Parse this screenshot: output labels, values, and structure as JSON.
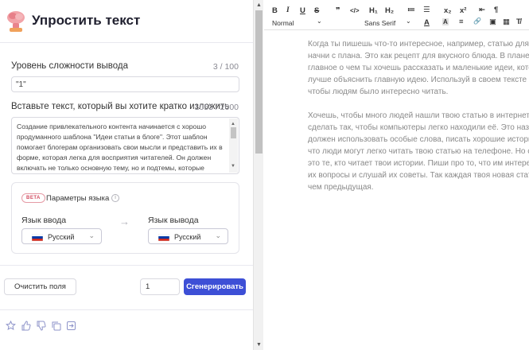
{
  "header": {
    "title": "Упростить текст"
  },
  "complexity": {
    "label": "Уровень сложности вывода",
    "count": "3 / 100",
    "value": "\"1\""
  },
  "source": {
    "label": "Вставьте текст, который вы хотите кратко изложить",
    "count": "1053 / 2000",
    "lines": [
      "Создание привлекательного контента начинается с хорошо",
      "продуманного шаблона \"Идеи статьи в блоге\". Этот шаблон",
      "помогает блогерам организовать свои мысли и представить их в",
      "форме, которая легка для восприятия читателей. Он должен",
      "включать не только основную тему, но и подтемы, которые"
    ]
  },
  "language": {
    "beta": "BETA",
    "title": "Параметры языка",
    "input_label": "Язык ввода",
    "output_label": "Язык вывода",
    "input_value": "Русский",
    "output_value": "Русский",
    "flag_colors": [
      "#ffffff",
      "#0039a6",
      "#d52b1e"
    ]
  },
  "actions": {
    "clear": "Очистить поля",
    "quantity": "1",
    "generate": "Сгенерировать"
  },
  "toolbar": {
    "bold": "B",
    "italic": "I",
    "underline": "U",
    "strike": "S",
    "quote": "❞",
    "code": "</>",
    "h1": "H₁",
    "h2": "H₂",
    "ol": "≔",
    "ul": "☰",
    "sub": "x₂",
    "sup": "x²",
    "indent": "⇤",
    "rtl": "¶",
    "format": "Normal",
    "font": "Sans Serif",
    "font_color": "A",
    "bg_color": "A",
    "align": "≡",
    "link": "🔗",
    "image": "▣",
    "video": "▦",
    "clean": "T̸",
    "source": "<>"
  },
  "editor": {
    "paragraphs": [
      [
        "Когда ты пишешь что-то интересное, например, статью для с",
        "начни с плана. Это как рецепт для вкусного блюда. В плане д",
        "главное о чем ты хочешь рассказать и маленькие идеи, котор",
        "лучше объяснить главную идею. Используй в своем тексте р",
        "чтобы людям было интересно читать."
      ],
      [
        "Хочешь, чтобы много людей нашли твою статью в интернете",
        "сделать так, чтобы компьютеры легко находили её. Это назы",
        "должен использовать особые слова, писать хорошие истори",
        "что люди могут легко читать твою статью на телефоне. Но са",
        "это те, кто читает твои истории. Пиши про то, что им интерес",
        "их вопросы и слушай их советы. Так каждая твоя новая стать",
        "чем предыдущая."
      ]
    ]
  }
}
